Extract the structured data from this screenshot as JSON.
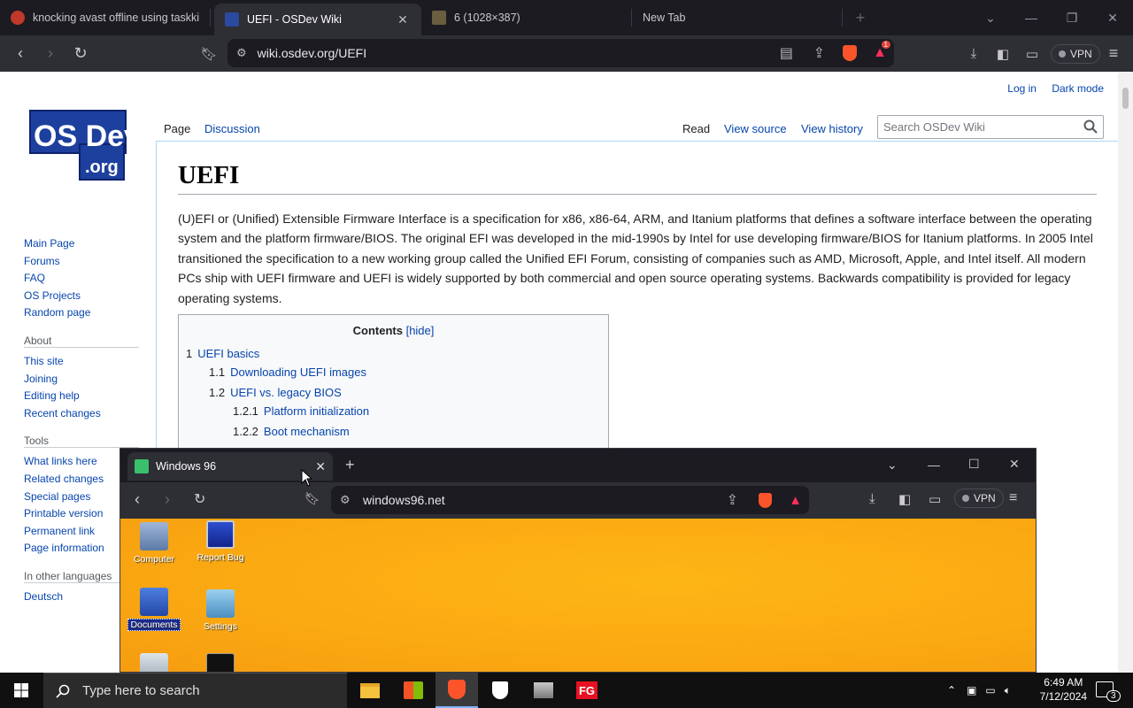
{
  "browser": {
    "tabs": [
      {
        "title": "knocking avast offline using taskkill",
        "active": false
      },
      {
        "title": "UEFI - OSDev Wiki",
        "active": true
      },
      {
        "title": "6 (1028×387)",
        "active": false
      },
      {
        "title": "New Tab",
        "active": false
      }
    ],
    "url": "wiki.osdev.org/UEFI",
    "vpn_label": "VPN",
    "shield_badge": "",
    "alert_badge": "1"
  },
  "wiki": {
    "logo_text_top": "OS Dev",
    "logo_text_bottom": ".org",
    "personal": {
      "login": "Log in",
      "dark": "Dark mode"
    },
    "page_tabs": {
      "page": "Page",
      "discussion": "Discussion",
      "read": "Read",
      "view_source": "View source",
      "view_history": "View history"
    },
    "search_placeholder": "Search OSDev Wiki",
    "sidebar": {
      "nav": [
        "Main Page",
        "Forums",
        "FAQ",
        "OS Projects",
        "Random page"
      ],
      "about_heading": "About",
      "about": [
        "This site",
        "Joining",
        "Editing help",
        "Recent changes"
      ],
      "tools_heading": "Tools",
      "tools": [
        "What links here",
        "Related changes",
        "Special pages",
        "Printable version",
        "Permanent link",
        "Page information"
      ],
      "lang_heading": "In other languages",
      "langs": [
        "Deutsch"
      ]
    },
    "title": "UEFI",
    "intro": "(U)EFI or (Unified) Extensible Firmware Interface is a specification for x86, x86-64, ARM, and Itanium platforms that defines a software interface between the operating system and the platform firmware/BIOS. The original EFI was developed in the mid-1990s by Intel for use developing firmware/BIOS for Itanium platforms. In 2005 Intel transitioned the specification to a new working group called the Unified EFI Forum, consisting of companies such as AMD, Microsoft, Apple, and Intel itself. All modern PCs ship with UEFI firmware and UEFI is widely supported by both commercial and open source operating systems. Backwards compatibility is provided for legacy operating systems.",
    "toc": {
      "title": "Contents",
      "hide": "[hide]",
      "items": [
        {
          "num": "1",
          "text": "UEFI basics"
        },
        {
          "num": "1.1",
          "text": "Downloading UEFI images"
        },
        {
          "num": "1.2",
          "text": "UEFI vs. legacy BIOS"
        },
        {
          "num": "1.2.1",
          "text": "Platform initialization"
        },
        {
          "num": "1.2.2",
          "text": "Boot mechanism"
        }
      ]
    }
  },
  "inner_window": {
    "tab_title": "Windows 96",
    "url": "windows96.net",
    "vpn_label": "VPN",
    "desktop_icons": [
      {
        "label": "Computer"
      },
      {
        "label": "Report Bug"
      },
      {
        "label": "Documents"
      },
      {
        "label": "Settings"
      }
    ]
  },
  "taskbar": {
    "search_placeholder": "Type here to search",
    "time": "6:49 AM",
    "date": "7/12/2024",
    "notifications": "3"
  }
}
